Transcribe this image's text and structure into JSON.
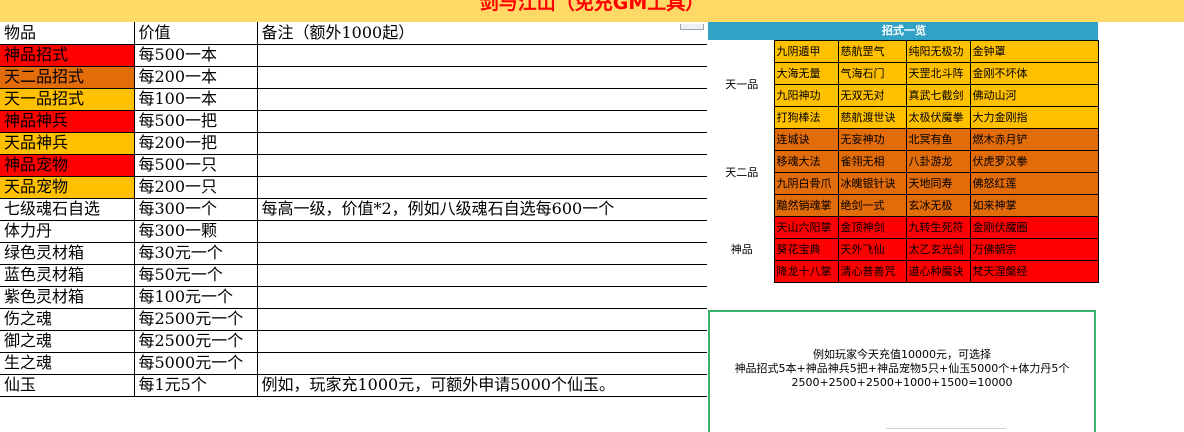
{
  "title": "剑与江山（免充GM工具）",
  "price_table": {
    "headers": {
      "item": "物品",
      "price": "价值",
      "note": "备注（额外1000起）"
    },
    "rows": [
      {
        "item": "神品招式",
        "price": "每500一本",
        "note": "",
        "bg": "#ff0000"
      },
      {
        "item": "天二品招式",
        "price": "每200一本",
        "note": "",
        "bg": "#e26b0a"
      },
      {
        "item": "天一品招式",
        "price": "每100一本",
        "note": "",
        "bg": "#ffc000"
      },
      {
        "item": "神品神兵",
        "price": "每500一把",
        "note": "",
        "bg": "#ff0000"
      },
      {
        "item": "天品神兵",
        "price": "每200一把",
        "note": "",
        "bg": "#ffc000"
      },
      {
        "item": "神品宠物",
        "price": "每500一只",
        "note": "",
        "bg": "#ff0000"
      },
      {
        "item": "天品宠物",
        "price": "每200一只",
        "note": "",
        "bg": "#ffc000"
      },
      {
        "item": "七级魂石自选",
        "price": "每300一个",
        "note": "每高一级，价值*2，例如八级魂石自选每600一个",
        "bg": ""
      },
      {
        "item": "体力丹",
        "price": "每300一颗",
        "note": "",
        "bg": ""
      },
      {
        "item": "绿色灵材箱",
        "price": "每30元一个",
        "note": "",
        "bg": ""
      },
      {
        "item": "蓝色灵材箱",
        "price": "每50元一个",
        "note": "",
        "bg": ""
      },
      {
        "item": "紫色灵材箱",
        "price": "每100元一个",
        "note": "",
        "bg": ""
      },
      {
        "item": "伤之魂",
        "price": "每2500元一个",
        "note": "",
        "bg": ""
      },
      {
        "item": "御之魂",
        "price": "每2500元一个",
        "note": "",
        "bg": ""
      },
      {
        "item": "生之魂",
        "price": "每5000元一个",
        "note": "",
        "bg": ""
      },
      {
        "item": "仙玉",
        "price": "每1元5个",
        "note": "例如，玩家充1000元，可额外申请5000个仙玉。",
        "bg": ""
      }
    ]
  },
  "moves_panel": {
    "title": "招式一览",
    "groups": [
      {
        "label": "天一品",
        "color": "#ffc000",
        "rows": [
          [
            "九阴遁甲",
            "慈航罡气",
            "纯阳无极功",
            "金钟罩"
          ],
          [
            "大海无量",
            "气海石门",
            "天罡北斗阵",
            "金刚不坏体"
          ],
          [
            "九阳神功",
            "无双无对",
            "真武七截剑",
            "佛动山河"
          ],
          [
            "打狗棒法",
            "慈航渡世诀",
            "太极伏魔拳",
            "大力金刚指"
          ]
        ]
      },
      {
        "label": "天二品",
        "color": "#e26b0a",
        "rows": [
          [
            "连城诀",
            "无妄神功",
            "北冥有鱼",
            "燃木赤月铲"
          ],
          [
            "移魂大法",
            "雀翎无相",
            "八卦游龙",
            "伏虎罗汉拳"
          ],
          [
            "九阴白骨爪",
            "冰魄银针诀",
            "天地同寿",
            "佛怒红莲"
          ],
          [
            "黯然销魂掌",
            "绝剑一式",
            "玄冰无极",
            "如来神掌"
          ]
        ]
      },
      {
        "label": "神品",
        "color": "#ff0000",
        "rows": [
          [
            "天山六阳掌",
            "金顶神剑",
            "九转生死符",
            "金刚伏魔圈"
          ],
          [
            "葵花宝典",
            "天外飞仙",
            "太乙玄光剑",
            "万佛朝宗"
          ],
          [
            "降龙十八掌",
            "清心普善咒",
            "道心种魔诀",
            "梵天涅槃经"
          ]
        ]
      }
    ]
  },
  "example_box": {
    "line1": "例如玩家今天充值10000元，可选择",
    "line2": "神品招式5本+神品神兵5把+神品宠物5只+仙玉5000个+体力丹5个",
    "line3": "2500+2500+2500+1000+1500=10000"
  }
}
